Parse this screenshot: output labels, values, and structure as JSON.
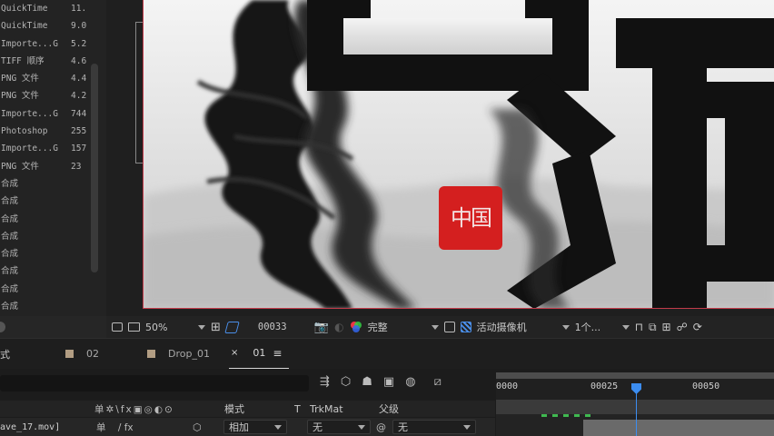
{
  "project_panel": {
    "rows": [
      {
        "type": "QuickTime",
        "size": "11."
      },
      {
        "type": "QuickTime",
        "size": "9.0"
      },
      {
        "type": "Importe...G",
        "size": "5.2"
      },
      {
        "type": "TIFF 顺序",
        "size": "4.6"
      },
      {
        "type": "PNG 文件",
        "size": "4.4"
      },
      {
        "type": "PNG 文件",
        "size": "4.2"
      },
      {
        "type": "Importe...G",
        "size": "744"
      },
      {
        "type": "Photoshop",
        "size": "255"
      },
      {
        "type": "Importe...G",
        "size": "157"
      },
      {
        "type": "PNG 文件",
        "size": "23"
      },
      {
        "type": "合成",
        "size": ""
      },
      {
        "type": "合成",
        "size": ""
      },
      {
        "type": "合成",
        "size": ""
      },
      {
        "type": "合成",
        "size": ""
      },
      {
        "type": "合成",
        "size": ""
      },
      {
        "type": "合成",
        "size": ""
      },
      {
        "type": "合成",
        "size": ""
      },
      {
        "type": "合成",
        "size": ""
      }
    ]
  },
  "composition": {
    "seal_text": "中国",
    "colors": {
      "seal": "#d41f1f",
      "ink": "#111111",
      "paper": "#e6e6e6"
    }
  },
  "viewer_bar": {
    "zoom": "50%",
    "timecode": "00033",
    "resolution": "完整",
    "camera": "活动摄像机",
    "views": "1个..."
  },
  "timeline": {
    "panel_label": "式",
    "tabs": [
      {
        "label": "02"
      },
      {
        "label": "Drop_01"
      },
      {
        "label": "01"
      }
    ],
    "columns": {
      "mode": "模式",
      "trkmat_t": "T",
      "trkmat": "TrkMat",
      "parent": "父级"
    },
    "layer": {
      "name": "ave_17.mov]",
      "mode": "相加",
      "trkmat": "无",
      "parent": "无"
    },
    "ruler_labels": [
      "0000",
      "00025",
      "00050"
    ],
    "accent_color": "#3c8df0"
  }
}
